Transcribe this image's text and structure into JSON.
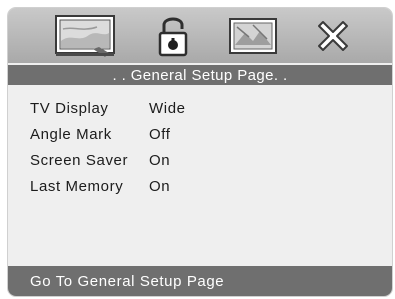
{
  "tabs": [
    {
      "id": "general",
      "icon": "tv-display-icon",
      "selected": true
    },
    {
      "id": "password",
      "icon": "padlock-icon",
      "selected": false
    },
    {
      "id": "preference",
      "icon": "picture-icon",
      "selected": false
    },
    {
      "id": "exit",
      "icon": "close-icon",
      "selected": false
    }
  ],
  "header": {
    "title": ". . General Setup Page. ."
  },
  "settings": [
    {
      "name": "TV Display",
      "value": "Wide"
    },
    {
      "name": "Angle Mark",
      "value": "Off"
    },
    {
      "name": "Screen Saver",
      "value": "On"
    },
    {
      "name": "Last Memory",
      "value": "On"
    }
  ],
  "footer": {
    "hint": "Go To General Setup Page"
  }
}
